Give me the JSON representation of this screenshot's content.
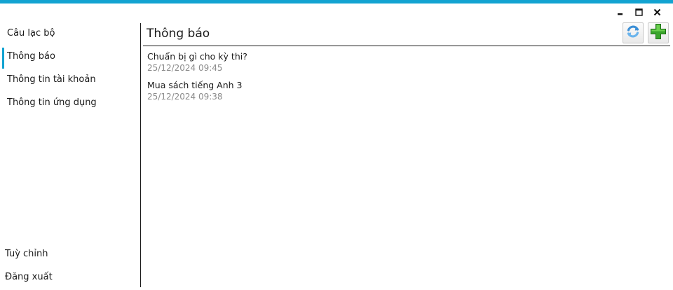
{
  "window": {
    "accent_color": "#12a3d1",
    "controls": [
      "minimize-icon",
      "maximize-icon",
      "close-icon"
    ]
  },
  "sidebar": {
    "items": [
      {
        "label": "Câu lạc bộ"
      },
      {
        "label": "Thông báo",
        "active": true
      },
      {
        "label": "Thông tin tài khoản"
      },
      {
        "label": "Thông tin ứng dụng"
      }
    ],
    "bottom_items": [
      {
        "label": "Tuỳ chỉnh"
      },
      {
        "label": "Đăng xuất"
      }
    ]
  },
  "main": {
    "title": "Thông báo",
    "actions": [
      "refresh-icon",
      "add-icon"
    ],
    "notifications": [
      {
        "title": "Chuẩn bị gì cho kỳ thi?",
        "time": "25/12/2024 09:45"
      },
      {
        "title": "Mua sách tiếng Anh 3",
        "time": "25/12/2024 09:38"
      }
    ]
  }
}
